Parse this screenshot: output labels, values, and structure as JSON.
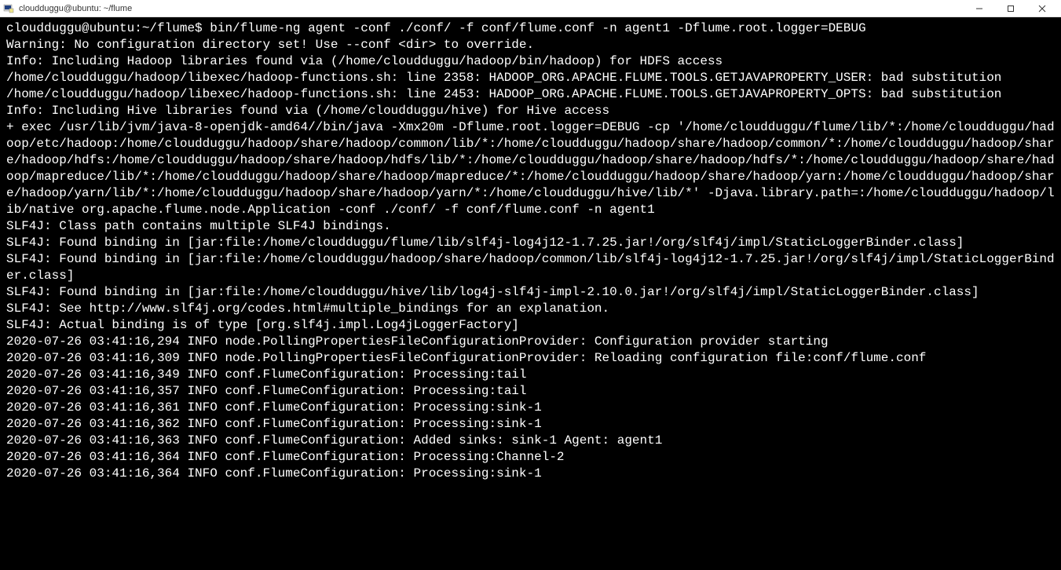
{
  "window": {
    "title": "cloudduggu@ubuntu: ~/flume"
  },
  "terminal": {
    "lines": [
      "cloudduggu@ubuntu:~/flume$ bin/flume-ng agent -conf ./conf/ -f conf/flume.conf -n agent1 -Dflume.root.logger=DEBUG",
      "Warning: No configuration directory set! Use --conf <dir> to override.",
      "Info: Including Hadoop libraries found via (/home/cloudduggu/hadoop/bin/hadoop) for HDFS access",
      "/home/cloudduggu/hadoop/libexec/hadoop-functions.sh: line 2358: HADOOP_ORG.APACHE.FLUME.TOOLS.GETJAVAPROPERTY_USER: bad substitution",
      "/home/cloudduggu/hadoop/libexec/hadoop-functions.sh: line 2453: HADOOP_ORG.APACHE.FLUME.TOOLS.GETJAVAPROPERTY_OPTS: bad substitution",
      "Info: Including Hive libraries found via (/home/cloudduggu/hive) for Hive access",
      "+ exec /usr/lib/jvm/java-8-openjdk-amd64//bin/java -Xmx20m -Dflume.root.logger=DEBUG -cp '/home/cloudduggu/flume/lib/*:/home/cloudduggu/hadoop/etc/hadoop:/home/cloudduggu/hadoop/share/hadoop/common/lib/*:/home/cloudduggu/hadoop/share/hadoop/common/*:/home/cloudduggu/hadoop/share/hadoop/hdfs:/home/cloudduggu/hadoop/share/hadoop/hdfs/lib/*:/home/cloudduggu/hadoop/share/hadoop/hdfs/*:/home/cloudduggu/hadoop/share/hadoop/mapreduce/lib/*:/home/cloudduggu/hadoop/share/hadoop/mapreduce/*:/home/cloudduggu/hadoop/share/hadoop/yarn:/home/cloudduggu/hadoop/share/hadoop/yarn/lib/*:/home/cloudduggu/hadoop/share/hadoop/yarn/*:/home/cloudduggu/hive/lib/*' -Djava.library.path=:/home/cloudduggu/hadoop/lib/native org.apache.flume.node.Application -conf ./conf/ -f conf/flume.conf -n agent1",
      "SLF4J: Class path contains multiple SLF4J bindings.",
      "SLF4J: Found binding in [jar:file:/home/cloudduggu/flume/lib/slf4j-log4j12-1.7.25.jar!/org/slf4j/impl/StaticLoggerBinder.class]",
      "SLF4J: Found binding in [jar:file:/home/cloudduggu/hadoop/share/hadoop/common/lib/slf4j-log4j12-1.7.25.jar!/org/slf4j/impl/StaticLoggerBinder.class]",
      "SLF4J: Found binding in [jar:file:/home/cloudduggu/hive/lib/log4j-slf4j-impl-2.10.0.jar!/org/slf4j/impl/StaticLoggerBinder.class]",
      "SLF4J: See http://www.slf4j.org/codes.html#multiple_bindings for an explanation.",
      "SLF4J: Actual binding is of type [org.slf4j.impl.Log4jLoggerFactory]",
      "2020-07-26 03:41:16,294 INFO node.PollingPropertiesFileConfigurationProvider: Configuration provider starting",
      "2020-07-26 03:41:16,309 INFO node.PollingPropertiesFileConfigurationProvider: Reloading configuration file:conf/flume.conf",
      "2020-07-26 03:41:16,349 INFO conf.FlumeConfiguration: Processing:tail",
      "2020-07-26 03:41:16,357 INFO conf.FlumeConfiguration: Processing:tail",
      "2020-07-26 03:41:16,361 INFO conf.FlumeConfiguration: Processing:sink-1",
      "2020-07-26 03:41:16,362 INFO conf.FlumeConfiguration: Processing:sink-1",
      "2020-07-26 03:41:16,363 INFO conf.FlumeConfiguration: Added sinks: sink-1 Agent: agent1",
      "2020-07-26 03:41:16,364 INFO conf.FlumeConfiguration: Processing:Channel-2",
      "2020-07-26 03:41:16,364 INFO conf.FlumeConfiguration: Processing:sink-1"
    ]
  }
}
